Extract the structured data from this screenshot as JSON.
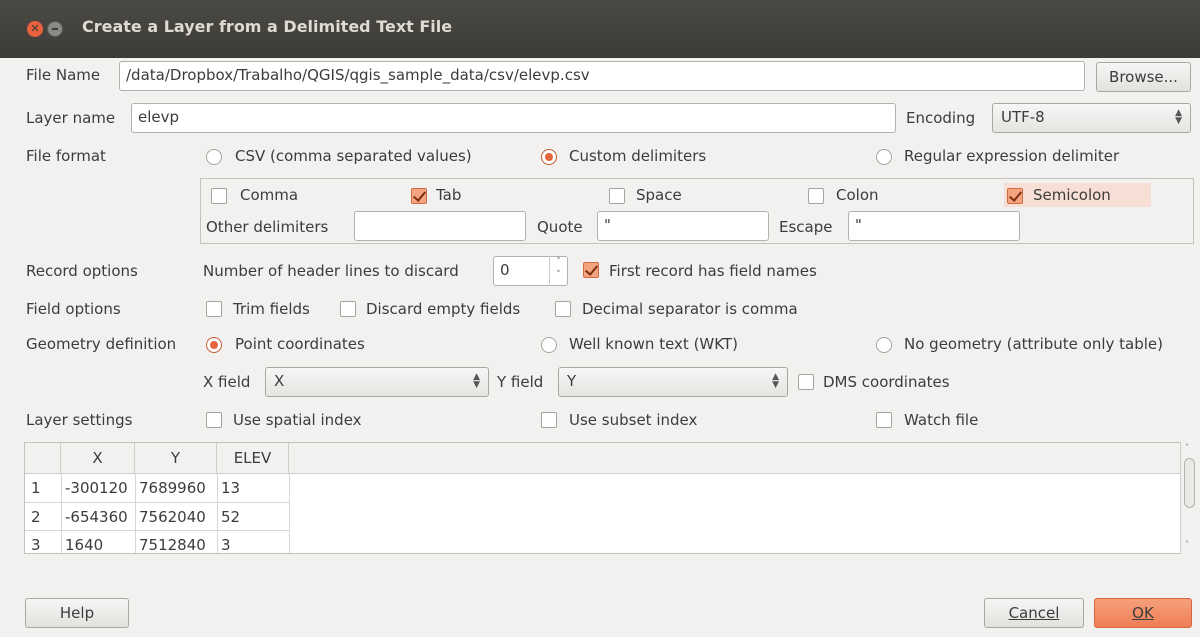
{
  "window": {
    "title": "Create a Layer from a Delimited Text File"
  },
  "file": {
    "label": "File Name",
    "value": "/data/Dropbox/Trabalho/QGIS/qgis_sample_data/csv/elevp.csv",
    "browse": "Browse..."
  },
  "layer": {
    "label": "Layer name",
    "value": "elevp",
    "encoding_label": "Encoding",
    "encoding_value": "UTF-8"
  },
  "format": {
    "label": "File format",
    "options": [
      "CSV (comma separated values)",
      "Custom delimiters",
      "Regular expression delimiter"
    ],
    "selected": "Custom delimiters",
    "delimiters": [
      {
        "label": "Comma",
        "checked": false
      },
      {
        "label": "Tab",
        "checked": true
      },
      {
        "label": "Space",
        "checked": false
      },
      {
        "label": "Colon",
        "checked": false
      },
      {
        "label": "Semicolon",
        "checked": true
      }
    ],
    "other_label": "Other delimiters",
    "other_value": "",
    "quote_label": "Quote",
    "quote_value": "\"",
    "escape_label": "Escape",
    "escape_value": "\""
  },
  "record": {
    "label": "Record options",
    "header_lines_label": "Number of header lines to discard",
    "header_lines_value": "0",
    "first_record_label": "First record has field names",
    "first_record_checked": true
  },
  "field": {
    "label": "Field options",
    "trim": "Trim fields",
    "discard_empty": "Discard empty fields",
    "decimal_comma": "Decimal separator is comma"
  },
  "geometry": {
    "label": "Geometry definition",
    "options": [
      "Point coordinates",
      "Well known text (WKT)",
      "No geometry (attribute only table)"
    ],
    "selected": "Point coordinates",
    "x_label": "X field",
    "x_value": "X",
    "y_label": "Y field",
    "y_value": "Y",
    "dms_label": "DMS coordinates"
  },
  "settings": {
    "label": "Layer settings",
    "spatial_index": "Use spatial index",
    "subset_index": "Use subset index",
    "watch_file": "Watch file"
  },
  "table": {
    "columns": [
      "X",
      "Y",
      "ELEV"
    ],
    "rows": [
      {
        "num": "1",
        "cells": [
          "-300120",
          "7689960",
          "13"
        ]
      },
      {
        "num": "2",
        "cells": [
          "-654360",
          "7562040",
          "52"
        ]
      },
      {
        "num": "3",
        "cells": [
          "1640",
          "7512840",
          "3"
        ]
      }
    ]
  },
  "buttons": {
    "help": "Help",
    "cancel": "Cancel",
    "ok": "OK"
  },
  "colors": {
    "accent": "#e5663d",
    "titlebar": "#3c3b37",
    "background": "#f2f1f0"
  }
}
